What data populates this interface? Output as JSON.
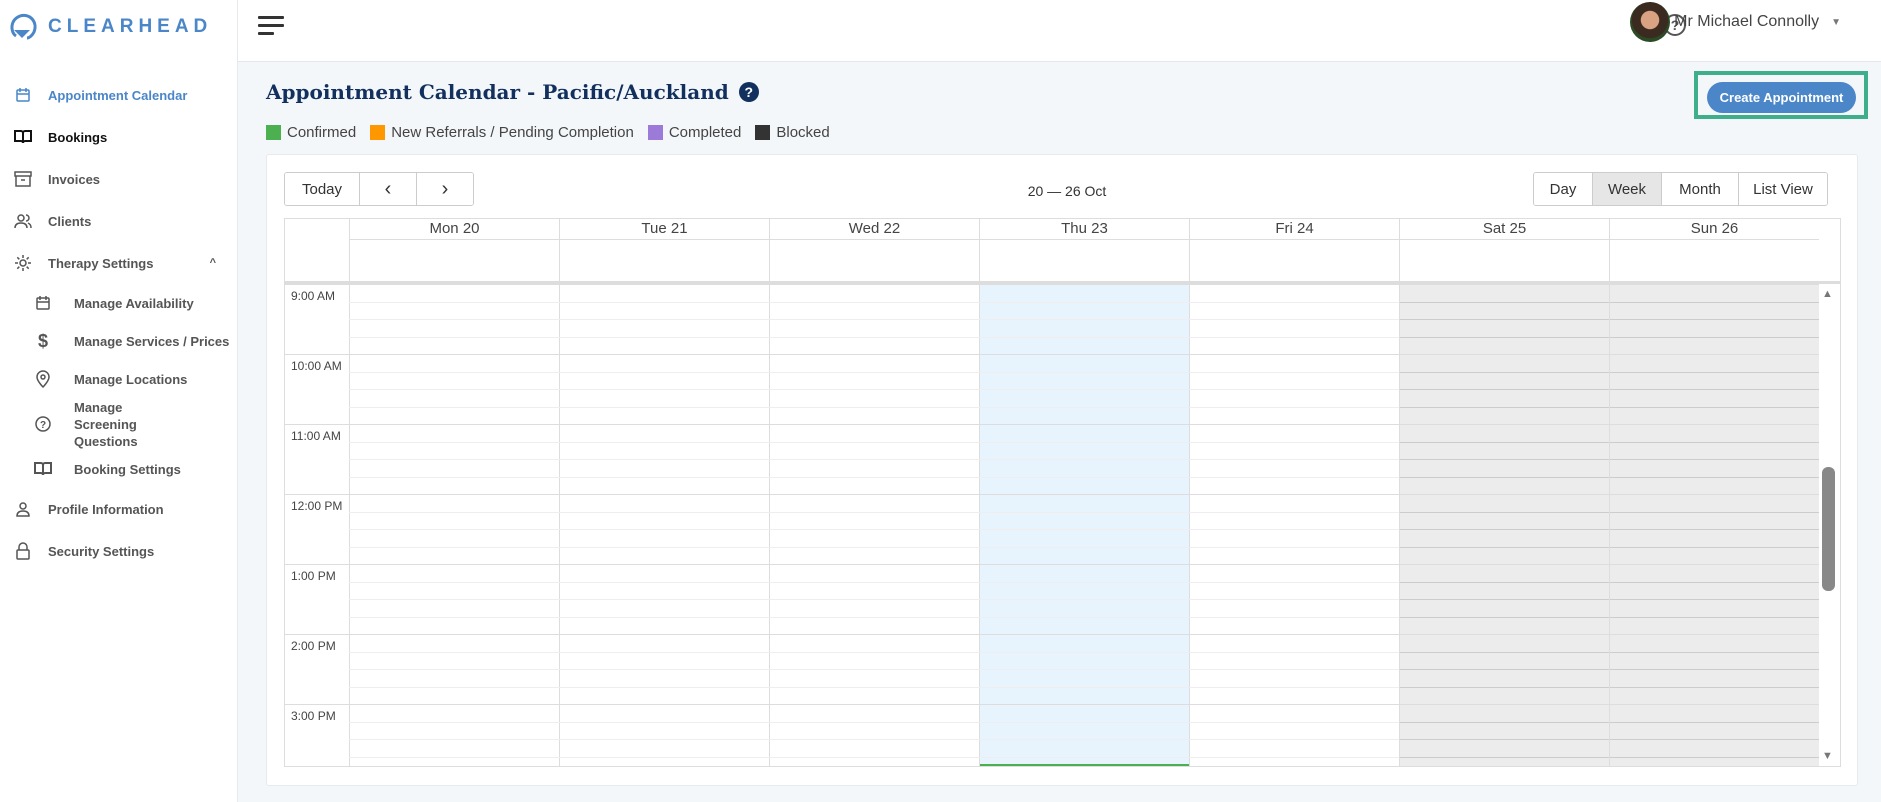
{
  "brand": {
    "name": "CLEARHEAD"
  },
  "sidebar": {
    "items": [
      {
        "label": "Appointment Calendar",
        "icon": "calendar-icon"
      },
      {
        "label": "Bookings",
        "icon": "book-icon"
      },
      {
        "label": "Invoices",
        "icon": "archive-icon"
      },
      {
        "label": "Clients",
        "icon": "users-icon"
      },
      {
        "label": "Therapy Settings",
        "icon": "gear-icon"
      },
      {
        "label": "Manage Availability",
        "icon": "calendar-icon"
      },
      {
        "label": "Manage Services / Prices",
        "icon": "dollar-icon"
      },
      {
        "label": "Manage Locations",
        "icon": "location-icon"
      },
      {
        "label": "Manage Screening Questions",
        "icon": "question-icon"
      },
      {
        "label": "Booking Settings",
        "icon": "book-icon"
      },
      {
        "label": "Profile Information",
        "icon": "user-icon"
      },
      {
        "label": "Security Settings",
        "icon": "lock-icon"
      }
    ]
  },
  "header": {
    "user_name": "Mr Michael Connolly",
    "help": "?"
  },
  "page": {
    "title": "Appointment Calendar - Pacific/Auckland",
    "help": "?",
    "create_label": "Create Appointment"
  },
  "legend": [
    {
      "label": "Confirmed",
      "color": "#4caf50"
    },
    {
      "label": "New Referrals / Pending Completion",
      "color": "#ff9800"
    },
    {
      "label": "Completed",
      "color": "#9c7bd8"
    },
    {
      "label": "Blocked",
      "color": "#333333"
    }
  ],
  "calendar": {
    "today_label": "Today",
    "prev": "‹",
    "next": "›",
    "range": "20 — 26 Oct",
    "views": [
      "Day",
      "Week",
      "Month",
      "List View"
    ],
    "active_view": "Week",
    "days": [
      "Mon 20",
      "Tue 21",
      "Wed 22",
      "Thu 23",
      "Fri 24",
      "Sat 25",
      "Sun 26"
    ],
    "times": [
      "9:00 AM",
      "10:00 AM",
      "11:00 AM",
      "12:00 PM",
      "1:00 PM",
      "2:00 PM",
      "3:00 PM"
    ]
  }
}
